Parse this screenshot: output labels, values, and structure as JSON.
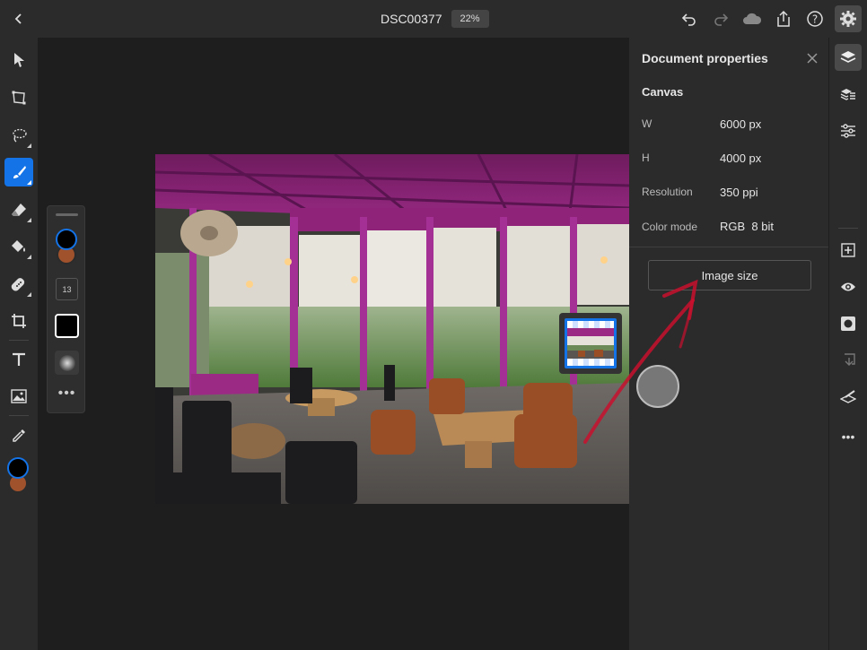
{
  "header": {
    "doc_title": "DSC00377",
    "zoom_label": "22%"
  },
  "icons": {
    "back": "chevron-left-icon",
    "undo": "undo-icon",
    "redo": "redo-icon",
    "cloud": "cloud-icon",
    "share": "share-icon",
    "help": "help-icon",
    "settings": "gear-icon"
  },
  "left_tools": [
    "select-icon",
    "transform-icon",
    "lasso-icon",
    "brush-icon",
    "eraser-icon",
    "fill-icon",
    "healing-icon",
    "crop-icon",
    "text-icon",
    "place-image-icon",
    "eyedropper-icon"
  ],
  "brush_panel": {
    "size_label": "13",
    "more_label": "•••"
  },
  "colors": {
    "accent": "#1473e6",
    "foreground_swatch": "#000000",
    "background_swatch": "#a0522d",
    "annotation_arrow": "#c8102e"
  },
  "properties_panel": {
    "title": "Document properties",
    "section": "Canvas",
    "rows": [
      {
        "label": "W",
        "value": "6000 px"
      },
      {
        "label": "H",
        "value": "4000 px"
      },
      {
        "label": "Resolution",
        "value": "350 ppi"
      },
      {
        "label": "Color mode",
        "value": "RGB  8 bit"
      }
    ],
    "image_size_button": "Image size"
  },
  "right_tools": [
    "layers-icon",
    "layer-properties-icon",
    "adjustments-icon",
    "add-layer-icon",
    "visibility-icon",
    "mask-icon",
    "merge-down-icon",
    "clear-layer-icon",
    "more-icon"
  ],
  "right_more_label": "•••"
}
